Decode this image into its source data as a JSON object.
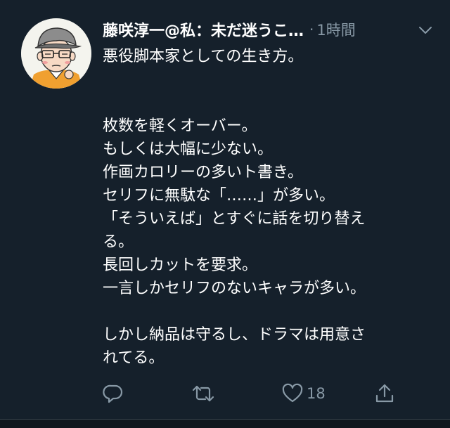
{
  "tweet": {
    "display_name": "藤咲淳一@私：未だ迷うこ…",
    "dot": "·",
    "timestamp": "1時間",
    "lines": [
      "悪役脚本家としての生き方。",
      "",
      "",
      "枚数を軽くオーバー。",
      "もしくは大幅に少ない。",
      "作画カロリーの多いト書き。",
      "セリフに無駄な「……」が多い。",
      "「そういえば」とすぐに話を切り替え",
      "る。",
      "長回しカットを要求。",
      "一言しかセリフのないキャラが多い。",
      "",
      "しかし納品は守るし、ドラマは用意さ",
      "れてる。"
    ],
    "like_count": "18"
  },
  "icons": {
    "avatar": "avatar-illustration",
    "caret": "chevron-down-icon",
    "reply": "reply-icon",
    "retweet": "retweet-icon",
    "like": "heart-icon",
    "share": "share-icon"
  },
  "colors": {
    "background": "#15202b",
    "text": "#ffffff",
    "secondary": "#8899a6"
  }
}
